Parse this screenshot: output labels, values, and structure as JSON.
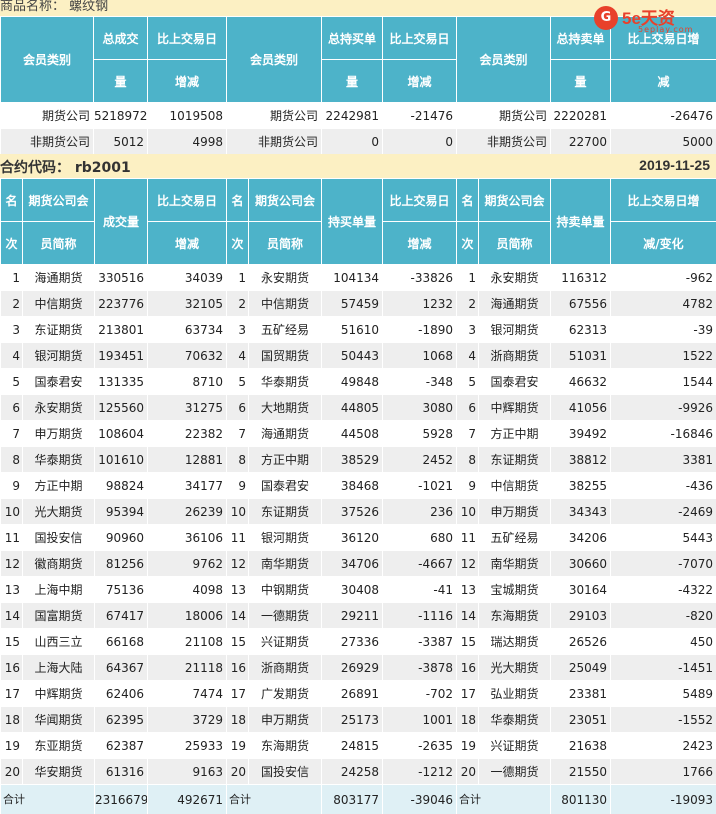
{
  "top_label": "商品名称： 螺纹钢",
  "logo": {
    "mark": "G",
    "brand": "5e天资",
    "sub": "5eplay.com"
  },
  "summary": {
    "headers": [
      [
        "会员类别",
        "总成交",
        "量",
        "比上交易日",
        "增减"
      ],
      [
        "会员类别",
        "总持买单",
        "量",
        "比上交易日",
        "增减"
      ],
      [
        "会员类别",
        "总持卖单",
        "量",
        "比上交易日增",
        "减"
      ]
    ],
    "rows": [
      [
        "期货公司",
        "5218972",
        "1019508",
        "期货公司",
        "2242981",
        "-21476",
        "期货公司",
        "2220281",
        "-26476"
      ],
      [
        "非期货公司",
        "5012",
        "4998",
        "非期货公司",
        "0",
        "0",
        "非期货公司",
        "22700",
        "5000"
      ]
    ]
  },
  "contract": {
    "label": "合约代码： rb2001",
    "date": "2019-11-25"
  },
  "ranking": {
    "headers": [
      [
        "名",
        "次",
        "期货公司会",
        "员简称",
        "成交量",
        "比上交易日",
        "增减"
      ],
      [
        "名",
        "次",
        "期货公司会",
        "员简称",
        "持买单量",
        "比上交易日",
        "增减"
      ],
      [
        "名",
        "次",
        "期货公司会",
        "员简称",
        "持卖单量",
        "比上交易日增",
        "减/变化"
      ]
    ],
    "rows": [
      [
        "1",
        "海通期货",
        "330516",
        "34039",
        "1",
        "永安期货",
        "104134",
        "-33826",
        "1",
        "永安期货",
        "116312",
        "-962"
      ],
      [
        "2",
        "中信期货",
        "223776",
        "32105",
        "2",
        "中信期货",
        "57459",
        "1232",
        "2",
        "海通期货",
        "67556",
        "4782"
      ],
      [
        "3",
        "东证期货",
        "213801",
        "63734",
        "3",
        "五矿经易",
        "51610",
        "-1890",
        "3",
        "银河期货",
        "62313",
        "-39"
      ],
      [
        "4",
        "银河期货",
        "193451",
        "70632",
        "4",
        "国贸期货",
        "50443",
        "1068",
        "4",
        "浙商期货",
        "51031",
        "1522"
      ],
      [
        "5",
        "国泰君安",
        "131335",
        "8710",
        "5",
        "华泰期货",
        "49848",
        "-348",
        "5",
        "国泰君安",
        "46632",
        "1544"
      ],
      [
        "6",
        "永安期货",
        "125560",
        "31275",
        "6",
        "大地期货",
        "44805",
        "3080",
        "6",
        "中辉期货",
        "41056",
        "-9926"
      ],
      [
        "7",
        "申万期货",
        "108604",
        "22382",
        "7",
        "海通期货",
        "44508",
        "5928",
        "7",
        "方正中期",
        "39492",
        "-16846"
      ],
      [
        "8",
        "华泰期货",
        "101610",
        "12881",
        "8",
        "方正中期",
        "38529",
        "2452",
        "8",
        "东证期货",
        "38812",
        "3381"
      ],
      [
        "9",
        "方正中期",
        "98824",
        "34177",
        "9",
        "国泰君安",
        "38468",
        "-1021",
        "9",
        "中信期货",
        "38255",
        "-436"
      ],
      [
        "10",
        "光大期货",
        "95394",
        "26239",
        "10",
        "东证期货",
        "37526",
        "236",
        "10",
        "申万期货",
        "34343",
        "-2469"
      ],
      [
        "11",
        "国投安信",
        "90960",
        "36106",
        "11",
        "银河期货",
        "36120",
        "680",
        "11",
        "五矿经易",
        "34206",
        "5443"
      ],
      [
        "12",
        "徽商期货",
        "81256",
        "9762",
        "12",
        "南华期货",
        "34706",
        "-4667",
        "12",
        "南华期货",
        "30660",
        "-7070"
      ],
      [
        "13",
        "上海中期",
        "75136",
        "4098",
        "13",
        "中钢期货",
        "30408",
        "-41",
        "13",
        "宝城期货",
        "30164",
        "-4322"
      ],
      [
        "14",
        "国富期货",
        "67417",
        "18006",
        "14",
        "一德期货",
        "29211",
        "-1116",
        "14",
        "东海期货",
        "29103",
        "-820"
      ],
      [
        "15",
        "山西三立",
        "66168",
        "21108",
        "15",
        "兴证期货",
        "27336",
        "-3387",
        "15",
        "瑞达期货",
        "26526",
        "450"
      ],
      [
        "16",
        "上海大陆",
        "64367",
        "21118",
        "16",
        "浙商期货",
        "26929",
        "-3878",
        "16",
        "光大期货",
        "25049",
        "-1451"
      ],
      [
        "17",
        "中辉期货",
        "62406",
        "7474",
        "17",
        "广发期货",
        "26891",
        "-702",
        "17",
        "弘业期货",
        "23381",
        "5489"
      ],
      [
        "18",
        "华闻期货",
        "62395",
        "3729",
        "18",
        "申万期货",
        "25173",
        "1001",
        "18",
        "华泰期货",
        "23051",
        "-1552"
      ],
      [
        "19",
        "东亚期货",
        "62387",
        "25933",
        "19",
        "东海期货",
        "24815",
        "-2635",
        "19",
        "兴证期货",
        "21638",
        "2423"
      ],
      [
        "20",
        "华安期货",
        "61316",
        "9163",
        "20",
        "国投安信",
        "24258",
        "-1212",
        "20",
        "一德期货",
        "21550",
        "1766"
      ]
    ],
    "total": [
      "合计",
      "2316679",
      "492671",
      "合计",
      "803177",
      "-39046",
      "合计",
      "801130",
      "-19093"
    ]
  }
}
